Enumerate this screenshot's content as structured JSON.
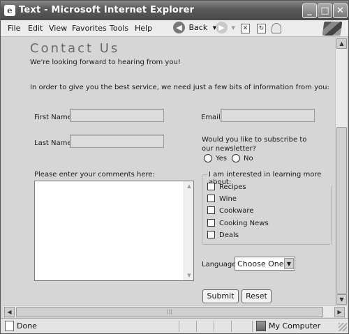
{
  "window": {
    "title": "Text - Microsoft Internet Explorer",
    "minimize": "_",
    "maximize": "□",
    "close": "✕"
  },
  "menu": [
    "File",
    "Edit",
    "View",
    "Favorites",
    "Tools",
    "Help"
  ],
  "toolbar": {
    "back_label": "Back"
  },
  "page": {
    "heading": "Contact Us",
    "intro": "We're looking forward to hearing from you!",
    "instructions": "In order to give you the best service, we need just a few bits of information from you:",
    "first_name_label": "First Name:",
    "last_name_label": "Last Name:",
    "email_label": "Email:",
    "first_name_value": "",
    "last_name_value": "",
    "email_value": "",
    "newsletter_question": "Would you like to subscribe to our newsletter?",
    "newsletter_options": [
      "Yes",
      "No"
    ],
    "comments_label": "Please enter your comments here:",
    "comments_value": "",
    "interests_legend": "I am interested in learning more about:",
    "interests": [
      "Recipes",
      "Wine",
      "Cookware",
      "Cooking News",
      "Deals"
    ],
    "language_label": "Language:",
    "language_selected": "Choose One",
    "submit_label": "Submit",
    "reset_label": "Reset"
  },
  "status": {
    "text": "Done",
    "zone": "My Computer"
  }
}
